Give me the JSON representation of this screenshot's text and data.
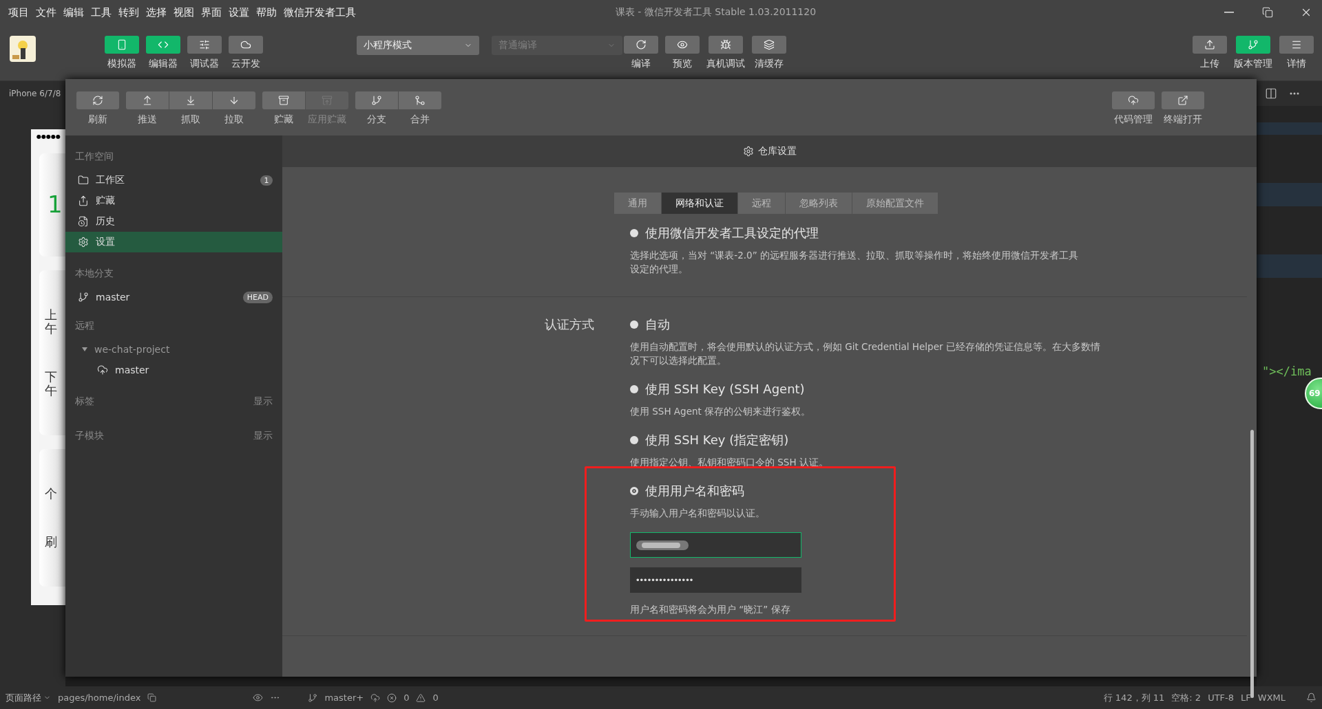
{
  "menu_bar": {
    "items": [
      "项目",
      "文件",
      "编辑",
      "工具",
      "转到",
      "选择",
      "视图",
      "界面",
      "设置",
      "帮助",
      "微信开发者工具"
    ],
    "title": "课表 - 微信开发者工具 Stable 1.03.2011120"
  },
  "toolbar": {
    "view_buttons": [
      {
        "label": "模拟器",
        "active": true
      },
      {
        "label": "编辑器",
        "active": true
      },
      {
        "label": "调试器",
        "active": false
      },
      {
        "label": "云开发",
        "active": false
      }
    ],
    "mode_select": {
      "value": "小程序模式"
    },
    "compile_select": {
      "value": "普通编译",
      "disabled": true
    },
    "action_buttons": [
      {
        "label": "编译"
      },
      {
        "label": "预览"
      },
      {
        "label": "真机调试"
      },
      {
        "label": "清缓存"
      }
    ],
    "right_buttons": [
      {
        "label": "上传",
        "active": false
      },
      {
        "label": "版本管理",
        "active": true
      },
      {
        "label": "详情",
        "active": false
      }
    ]
  },
  "simulator": {
    "device": "iPhone 6/7/8",
    "status": "●●●●●",
    "cards": [
      {
        "text": "1"
      },
      {
        "text": "上午"
      },
      {
        "text": "下午"
      },
      {
        "text": "个"
      },
      {
        "text": "刷"
      }
    ]
  },
  "git_panel": {
    "toolbar": {
      "buttons": [
        {
          "label": "刷新",
          "disabled": false
        },
        {
          "label": "推送",
          "disabled": false
        },
        {
          "label": "抓取",
          "disabled": false
        },
        {
          "label": "拉取",
          "disabled": false
        },
        {
          "label": "贮藏",
          "disabled": false
        },
        {
          "label": "应用贮藏",
          "disabled": true
        },
        {
          "label": "分支",
          "disabled": false
        },
        {
          "label": "合并",
          "disabled": false
        }
      ],
      "right_buttons": [
        {
          "label": "代码管理"
        },
        {
          "label": "终端打开"
        }
      ]
    },
    "sidebar": {
      "workspace": {
        "title": "工作空间",
        "items": [
          {
            "label": "工作区",
            "badge": "1",
            "selected": false
          },
          {
            "label": "贮藏",
            "selected": false
          },
          {
            "label": "历史",
            "selected": false
          },
          {
            "label": "设置",
            "selected": true
          }
        ]
      },
      "local_branches": {
        "title": "本地分支",
        "items": [
          {
            "label": "master",
            "tag": "HEAD"
          }
        ]
      },
      "remotes": {
        "title": "远程",
        "items": [
          {
            "label": "we-chat-project",
            "expanded": true,
            "children": [
              {
                "label": "master"
              }
            ]
          }
        ]
      },
      "tags": {
        "title": "标签",
        "action": "显示"
      },
      "submodules": {
        "title": "子模块",
        "action": "显示"
      }
    },
    "header": "仓库设置",
    "tabs": [
      {
        "label": "通用",
        "selected": false
      },
      {
        "label": "网络和认证",
        "selected": true
      },
      {
        "label": "远程",
        "selected": false
      },
      {
        "label": "忽略列表",
        "selected": false
      },
      {
        "label": "原始配置文件",
        "selected": false
      }
    ],
    "proxy_option": {
      "label": "使用微信开发者工具设定的代理",
      "selected": false,
      "description": "选择此选项，当对 “课表-2.0” 的远程服务器进行推送、拉取、抓取等操作时，将始终使用微信开发者工具设定的代理。"
    },
    "auth": {
      "label": "认证方式",
      "options": [
        {
          "label": "自动",
          "selected": false,
          "description": "使用自动配置时，将会使用默认的认证方式，例如 Git Credential Helper 已经存储的凭证信息等。在大多数情况下可以选择此配置。"
        },
        {
          "label": "使用 SSH Key (SSH Agent)",
          "selected": false,
          "description": "使用 SSH Agent 保存的公钥来进行鉴权。"
        },
        {
          "label": "使用 SSH Key (指定密钥)",
          "selected": false,
          "description": "使用指定公钥、私钥和密码口令的 SSH 认证。"
        },
        {
          "label": "使用用户名和密码",
          "selected": true,
          "description": "手动输入用户名和密码以认证。"
        }
      ]
    },
    "username_field": {
      "focused": true
    },
    "password_field": {
      "value": "•••••••••••••••",
      "focused": false
    },
    "save_note": "用户名和密码将会为用户 “晓江” 保存"
  },
  "editor": {
    "code": "\"></ima",
    "badge": "69"
  },
  "status_bar": {
    "path_menu": "页面路径",
    "path": "pages/home/index",
    "branch": "master+",
    "errors": "0",
    "warnings": "0",
    "position": "行 142，列 11",
    "indent": "空格: 2",
    "encoding": "UTF-8",
    "eol": "LF",
    "language": "WXML"
  }
}
